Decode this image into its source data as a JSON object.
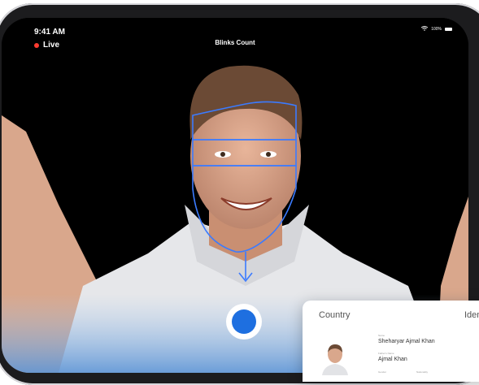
{
  "status": {
    "time": "9:41 AM",
    "live_label": "Live",
    "battery_label": "100%"
  },
  "screen": {
    "title": "Blinks Count"
  },
  "id_card": {
    "country_label": "Country",
    "identity_label": "Iden",
    "name_label": "Name",
    "name_value": "Sheharyar Ajmal Khan",
    "father_label": "Father's Name",
    "father_value": "Ajmal Khan",
    "gender_label": "Gender",
    "country_stay_label": "Nationality"
  },
  "colors": {
    "accent": "#1e6fe0",
    "live": "#ff3b30",
    "face_mesh": "#3b7bff"
  }
}
